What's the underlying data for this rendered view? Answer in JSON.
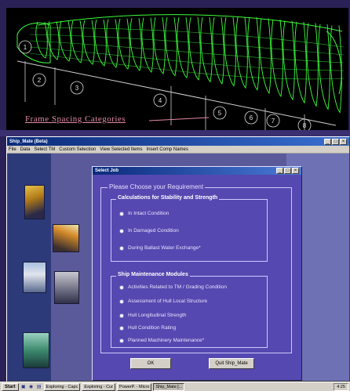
{
  "figure": {
    "caption": "Frame Spacing Categories",
    "frame_numbers": [
      "1",
      "2",
      "3",
      "4",
      "5",
      "6",
      "7",
      "8"
    ]
  },
  "window": {
    "title": "Ship_Mate (Beta)",
    "menu": [
      "File",
      "Data",
      "Select TM",
      "Custom Selection",
      "View Selected Items",
      "Insert Comp Names"
    ]
  },
  "dialog": {
    "title": "Select Job",
    "legend": "Please Choose your Requirement",
    "groups": [
      {
        "title": "Calculations for Stability and Strength",
        "options": [
          "In Intact Condition",
          "In Damaged Condition",
          "During Ballast Water Exchange*"
        ]
      },
      {
        "title": "Ship Maintenance Modules",
        "options": [
          "Activities Related to TM / Grading Condition",
          "Assessment of Hull Local Structure",
          "Hull Longitudinal Strength",
          "Hull Condition Rating",
          "Planned Machinery Maintenance*"
        ]
      }
    ],
    "ok_label": "OK",
    "quit_label": "Quit Ship_Mate"
  },
  "taskbar": {
    "start_label": "Start",
    "items": [
      "Exploring - Capc",
      "Exploring - Cur",
      "PowerP. - Micro",
      "Ship_Mate [..."
    ],
    "clock": "4:25"
  },
  "colors": {
    "desktop": "#2a2256",
    "hull_lines": "#3cff3c",
    "caption": "#e38aa8",
    "dialog_bg": "#5548b0"
  }
}
